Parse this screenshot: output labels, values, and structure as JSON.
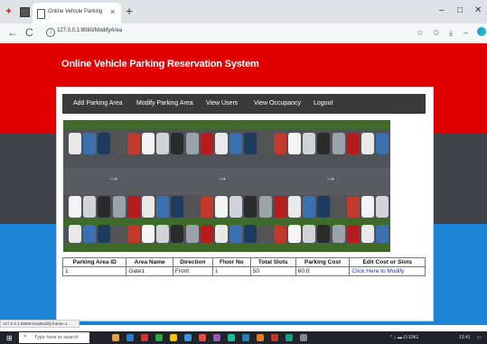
{
  "browser": {
    "tab_title": "Online Vehicle Parking",
    "tab_close": "×",
    "new_tab": "+",
    "url": "127.0.0.1:8080/ModifyArea",
    "back": "←",
    "refresh": "C",
    "window_min": "–",
    "window_max": "□",
    "window_close": "✕"
  },
  "site": {
    "title": "Online Vehicle Parking Reservation System"
  },
  "menu": {
    "items": [
      "Add Parking Area",
      "Modify Parking Area",
      "View Users",
      "View Occupancy",
      "Logout"
    ]
  },
  "table": {
    "headers": [
      "Parking Area ID",
      "Area Name",
      "Direction",
      "Floor No",
      "Total Slots",
      "Parking Cost",
      "Edit Cost or Slots"
    ],
    "rows": [
      [
        "1",
        "Gate1",
        "Front",
        "1",
        "50",
        "60.0",
        "Click Here to Modify"
      ]
    ]
  },
  "status_url": "127.0.0.1:8080/AreaModify.frame=1",
  "taskbar": {
    "search_placeholder": "Type here to search",
    "time": "13:41",
    "tray_text": "^ ⌂ ▬ ☊ ENG"
  },
  "colors": {
    "header_red": "#e00000",
    "band_dark": "#3f4246",
    "band_blue": "#1b84d4",
    "menu_bg": "#3a3a3a"
  }
}
